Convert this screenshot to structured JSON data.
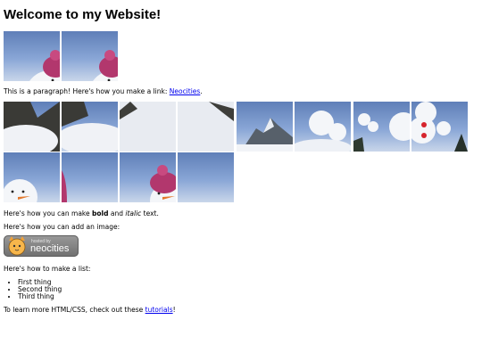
{
  "header": {
    "title": "Welcome to my Website!"
  },
  "intro": {
    "text": "This is a paragraph! Here's how you make a link: ",
    "link": "Neocities",
    "after": "."
  },
  "bold_line": {
    "prefix": "Here's how you can make ",
    "bold": "bold",
    "middle": " and ",
    "italic": "italic",
    "suffix": " text."
  },
  "image_line": {
    "text": "Here's how you can add an image:"
  },
  "badge": {
    "small": "hosted by",
    "big": "neocities"
  },
  "list_intro": {
    "text": "Here's how to make a list:"
  },
  "list": {
    "items": [
      "First thing",
      "Second thing",
      "Third thing"
    ]
  },
  "footer": {
    "text": "To learn more HTML/CSS, check out these ",
    "link": "tutorials",
    "after": "!"
  },
  "colors": {
    "link": "#0000ee",
    "sky": "#6f8fc6",
    "hat": "#b2376d",
    "snow": "#f4f6f9"
  }
}
